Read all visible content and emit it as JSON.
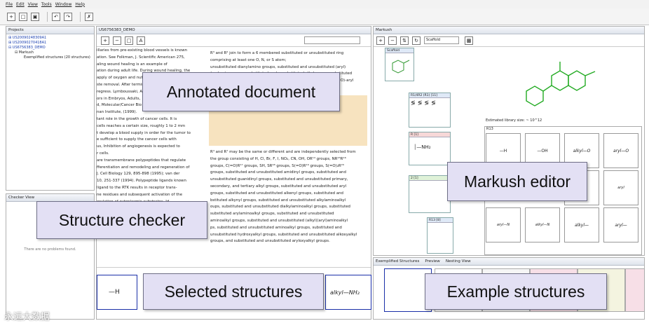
{
  "menu": [
    "File",
    "Edit",
    "View",
    "Tools",
    "Window",
    "Help"
  ],
  "projects": {
    "title": "Projects",
    "items": [
      "US20090248309A1",
      "US20090270418A1",
      "US6756383_DEMO",
      "Markush",
      "Exemplified structures (20 structures)"
    ]
  },
  "checker": {
    "title": "Checker View",
    "empty_text": "There are no problems found."
  },
  "document": {
    "tab": "US6756383_DEMO",
    "left_lines": [
      "illaries from pre-existing blood vessels is known",
      "ation. See Folkman, J. Scientific American 275,",
      "aling wound healing is an example of",
      "ation during adult life. During wound healing, the",
      "apply of oxygen and nutri",
      "ste removal. After termin",
      "regress. Lymboussaki, A",
      "ors in Embryos, Adults,",
      "d, Molecular/Cancer Bio",
      "nan Institute, (1999).",
      "",
      "tant role in the growth of cancer cells. It is",
      "cells reaches a certain size, roughly 1 to 2 mm",
      "t develop a blood supply in order for the tumor to",
      "e sufficient to supply the cancer cells with",
      "us, Inhibition of angiogenesis is expected to",
      "r cells.",
      "",
      "are transmembrane polypeptides that regulate",
      "fferentiation and remodeling and regeneration of",
      "J. Cell Biology 129, 895-898 (1995); van der",
      "10, 251-337 (1994). Polypeptide ligands known",
      "",
      "",
      "",
      "",
      "ligand to the RTK results in receptor trans-",
      "ne residues and subsequent activation of the",
      "orylation of cytoplasmic substrates. Id."
    ],
    "right_lines_a": [
      "R³ and R² join to form a 6 membered substituted or unsubstituted ring",
      "comprising at least one O, N, or S atom;",
      "",
      "",
      "",
      "",
      "",
      "",
      "unsubstituted dianylamino groups, substituted and unsubstituted (aryl)",
      "(arylamino groups, substituted and unsubstituted alkyl groups, substituted",
      "and unsubstituted aryl groups, C(=O)H, C(=O)-alkyl groups, and C(=O)-aryl",
      "groups;"
    ],
    "right_lines_b": [
      "R⁴ and R⁷ may be the same or different and are independently selected from",
      "the group consisting of H, Cl, Br, F, I, NO₂, CN, OH, OR¹⁴ groups, NR¹⁵R¹⁶",
      "groups, C(=O)R¹⁷ groups, SH, SR¹⁸ groups, S(=O)R¹⁹ groups, S(=O)₂R²⁰",
      "groups, substituted and unsubstituted amidinyl groups, substituted and",
      "unsubstituted guanidinyl groups, substituted and unsubstituted primary,",
      "secondary, and tertiary alkyl groups, substituted and unsubstituted aryl",
      "groups, substituted and unsubstituted alkenyl groups, substituted and",
      "bstituted alkynyl groups, substituted and unsubstituted alkylaminoalkyl",
      "oups, substituted and unsubstituted dialkylaminoalkyl groups, substituted",
      "substituted arylaminoalkyl groups, substituted and unsubstituted",
      "aminoalkyl groups, substituted and unsubstituted (alkyl)(aryl)aminoalkyl",
      "ps, substituted and unsubstituted aminoalkyl groups, substituted and",
      "unsubstituted hydroxyalkyl groups, substituted and unsubstituted alkoxyalkyl",
      "groups, and substituted and unsubstituted aryloxyalkyl groups."
    ]
  },
  "markush": {
    "tab": "Markush",
    "dropdown": "Scaffold",
    "scaffold_label": "Scaffold",
    "node1": "R1/4R2 (R1) [11]",
    "node2": "R [1]",
    "node3": "2 [1]",
    "node4": "R13 [8]",
    "library_size": "Estimated library size: ~ 10^12",
    "group_label": "R13",
    "cells": [
      "—H",
      "—OH",
      "alkyl—O",
      "aryl—O",
      "alkyl",
      "aryl",
      "aryl—N",
      "alkyl—N",
      "alkyl—",
      "aryl—"
    ]
  },
  "example": {
    "tabs": [
      "Exemplified Structures",
      "Preview",
      "Nesting View"
    ]
  },
  "selected": {
    "items": [
      "—H",
      "alkyl—NH₂"
    ]
  },
  "callouts": {
    "annotated": "Annotated document",
    "markush": "Markush editor",
    "checker": "Structure checker",
    "selected": "Selected structures",
    "example": "Example structures"
  },
  "watermark": "永远大数据"
}
